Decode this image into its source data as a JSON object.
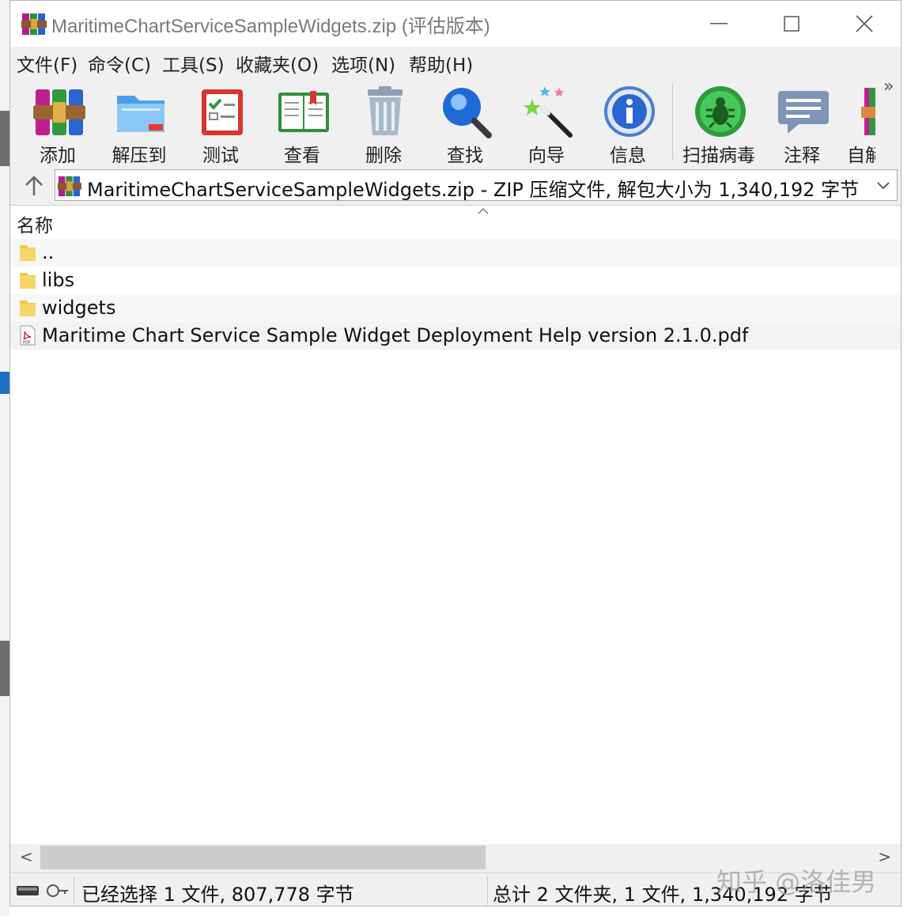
{
  "window": {
    "title": "MaritimeChartServiceSampleWidgets.zip (评估版本)",
    "minimize_label": "—",
    "maximize_label": "☐",
    "close_label": "✕"
  },
  "menu": [
    "文件(F)",
    "命令(C)",
    "工具(S)",
    "收藏夹(O)",
    "选项(N)",
    "帮助(H)"
  ],
  "toolbar": {
    "buttons": [
      "添加",
      "解压到",
      "测试",
      "查看",
      "删除",
      "查找",
      "向导",
      "信息",
      "扫描病毒",
      "注释",
      "自解"
    ],
    "more_label": "»"
  },
  "address": {
    "text": "MaritimeChartServiceSampleWidgets.zip - ZIP 压缩文件, 解包大小为 1,340,192 字节",
    "dropdown_glyph": "⌄"
  },
  "list": {
    "column_name": "名称",
    "sort_caret": "^",
    "items": [
      {
        "name": "..",
        "type": "folder"
      },
      {
        "name": "libs",
        "type": "folder"
      },
      {
        "name": "widgets",
        "type": "folder"
      },
      {
        "name": "Maritime Chart Service Sample Widget Deployment Help version 2.1.0.pdf",
        "type": "pdf"
      }
    ]
  },
  "scrollbar": {
    "left_arrow": "<",
    "right_arrow": ">"
  },
  "status": {
    "selected": "已经选择 1 文件, 807,778 字节",
    "total": "总计 2 文件夹, 1 文件, 1,340,192 字节"
  },
  "watermark": "知乎 @洛佳男",
  "colors": {
    "folder": "#f5c542",
    "pdf_red": "#c8102e",
    "window_bg": "#f0f0f0"
  }
}
